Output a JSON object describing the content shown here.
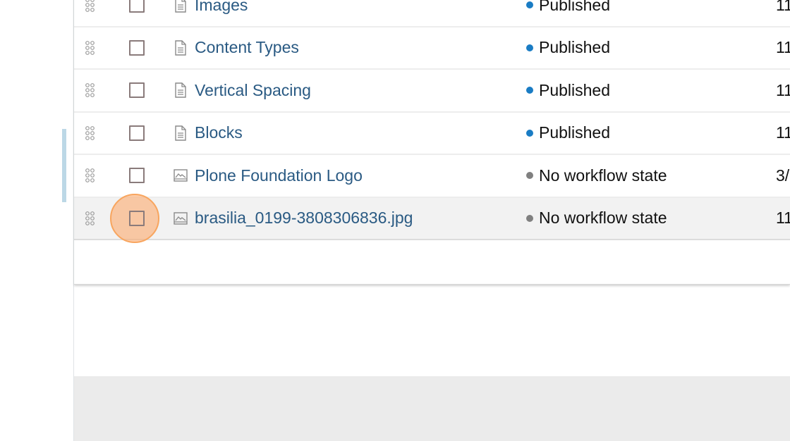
{
  "colors": {
    "published": "#1a7cc4",
    "no_state": "#808080",
    "link": "#2a5a83",
    "highlight": "#fcaa6e"
  },
  "rows": [
    {
      "title": "Images",
      "icon": "document-icon",
      "state": "Published",
      "state_type": "published",
      "date": "11"
    },
    {
      "title": "Content Types",
      "icon": "document-icon",
      "state": "Published",
      "state_type": "published",
      "date": "11"
    },
    {
      "title": "Vertical Spacing",
      "icon": "document-icon",
      "state": "Published",
      "state_type": "published",
      "date": "11"
    },
    {
      "title": "Blocks",
      "icon": "document-icon",
      "state": "Published",
      "state_type": "published",
      "date": "11"
    },
    {
      "title": "Plone Foundation Logo",
      "icon": "image-icon",
      "state": "No workflow state",
      "state_type": "none",
      "date": "3/"
    },
    {
      "title": "brasilia_0199-3808306836.jpg",
      "icon": "image-icon",
      "state": "No workflow state",
      "state_type": "none",
      "date": "11",
      "highlighted": true
    }
  ]
}
